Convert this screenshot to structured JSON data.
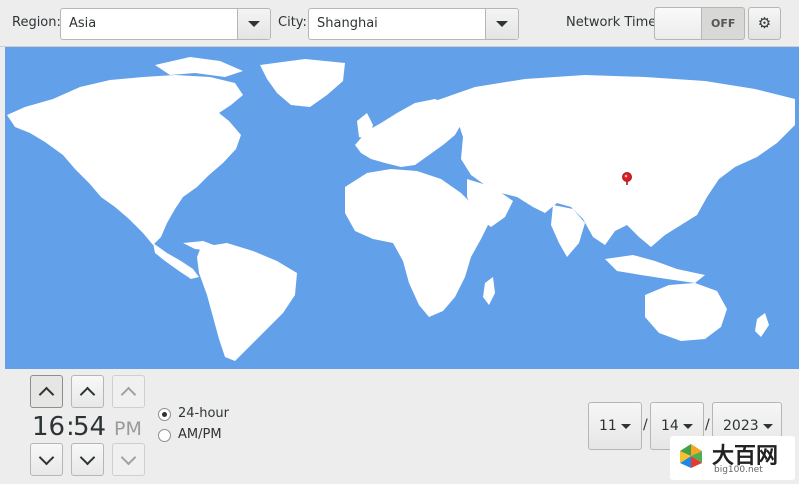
{
  "region": {
    "label": "Region:",
    "value": "Asia"
  },
  "city": {
    "label": "City:",
    "value": "Shanghai"
  },
  "network_time": {
    "label": "Network Time",
    "state": "OFF"
  },
  "colors": {
    "ocean": "#62a0ea",
    "land": "#ffffff",
    "pin": "#e01b24",
    "panel": "#ededed"
  },
  "time": {
    "hours": "16",
    "separator": ":",
    "minutes": "54",
    "ampm": "PM"
  },
  "format": {
    "option_24": "24-hour",
    "option_ampm": "AM/PM",
    "selected": "24-hour"
  },
  "date": {
    "month": "11",
    "day": "14",
    "year": "2023",
    "separator": "/"
  },
  "watermark": {
    "main": "大百网",
    "sub": "big100.net"
  }
}
